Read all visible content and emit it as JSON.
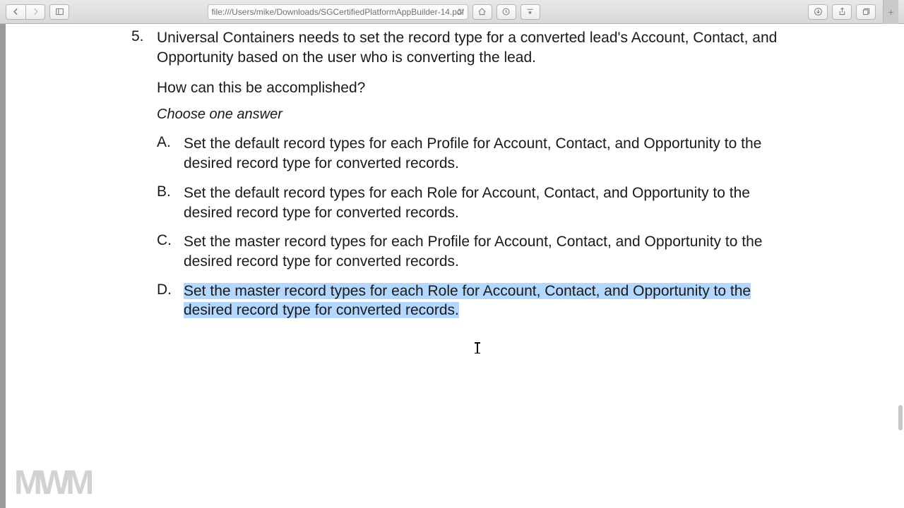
{
  "toolbar": {
    "url": "file:///Users/mike/Downloads/SGCertifiedPlatformAppBuilder-14.pdf"
  },
  "question": {
    "number": "5.",
    "text": "Universal Containers needs to set the record type for a converted lead's Account, Contact, and Opportunity based on the user who is converting the lead.",
    "subtext": "How can this be accomplished?",
    "instruction": "Choose one answer",
    "answers": [
      {
        "label": "A.",
        "text": "Set the default record types for each Profile for Account, Contact, and Opportunity to the desired record type for converted records.",
        "highlighted": false
      },
      {
        "label": "B.",
        "text": "Set the default record types for each Role for Account, Contact, and Opportunity to the desired record type for converted records.",
        "highlighted": false
      },
      {
        "label": "C.",
        "text": "Set the master record types for each Profile for Account, Contact, and Opportunity to the desired record type for converted records.",
        "highlighted": false
      },
      {
        "label": "D.",
        "text": "Set the master record types for each Role for Account, Contact, and Opportunity to the desired record type for converted records.",
        "highlighted": true
      }
    ]
  },
  "watermark": "MWM"
}
